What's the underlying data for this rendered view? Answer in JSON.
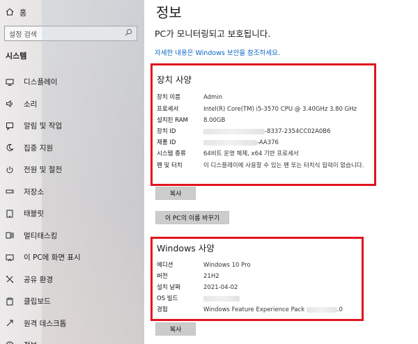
{
  "sidebar": {
    "home_label": "홈",
    "search_placeholder": "설정 검색",
    "section_title": "시스템",
    "items": [
      {
        "label": "디스플레이",
        "icon": "monitor-icon"
      },
      {
        "label": "소리",
        "icon": "speaker-icon"
      },
      {
        "label": "알림 및 작업",
        "icon": "notification-icon"
      },
      {
        "label": "집중 지원",
        "icon": "moon-icon"
      },
      {
        "label": "전원 및 절전",
        "icon": "power-icon"
      },
      {
        "label": "저장소",
        "icon": "storage-icon"
      },
      {
        "label": "태블릿",
        "icon": "tablet-icon"
      },
      {
        "label": "멀티태스킹",
        "icon": "multitasking-icon"
      },
      {
        "label": "이 PC에 화면 표시",
        "icon": "project-icon"
      },
      {
        "label": "공유 환경",
        "icon": "share-icon"
      },
      {
        "label": "클립보드",
        "icon": "clipboard-icon"
      },
      {
        "label": "원격 데스크톱",
        "icon": "remote-icon"
      },
      {
        "label": "정보",
        "icon": "info-icon"
      }
    ]
  },
  "main": {
    "title": "정보",
    "protect_text": "PC가 모니터링되고 보호됩니다.",
    "security_link": "자세한 내용은 Windows 보안을 참조하세요.",
    "device_specs": {
      "title": "장치 사양",
      "rows": [
        {
          "label": "장치 이름",
          "value": "Admin"
        },
        {
          "label": "프로세서",
          "value": "Intel(R) Core(TM) i5-3570 CPU @ 3.40GHz   3.80 GHz"
        },
        {
          "label": "설치된 RAM",
          "value": "8.00GB"
        },
        {
          "label": "장치 ID",
          "value": "-8337-2354CC02A0B6"
        },
        {
          "label": "제품 ID",
          "value": "-AA376"
        },
        {
          "label": "시스템 종류",
          "value": "64비트 운영 체제, x64 기반 프로세서"
        },
        {
          "label": "펜 및 터치",
          "value": "이 디스플레이에 사용할 수 있는 펜 또는 터치식 입력이 없습니다."
        }
      ]
    },
    "copy_button_1": "복사",
    "rename_button": "이 PC의 이름 바꾸기",
    "windows_specs": {
      "title": "Windows 사양",
      "rows": [
        {
          "label": "에디션",
          "value": "Windows 10 Pro"
        },
        {
          "label": "버전",
          "value": "21H2"
        },
        {
          "label": "설치 날짜",
          "value": "2021-04-02"
        },
        {
          "label": "OS 빌드",
          "value": ""
        },
        {
          "label": "경험",
          "value": "Windows Feature Experience Pack"
        }
      ],
      "experience_suffix": ".0"
    },
    "copy_button_2": "복사"
  }
}
